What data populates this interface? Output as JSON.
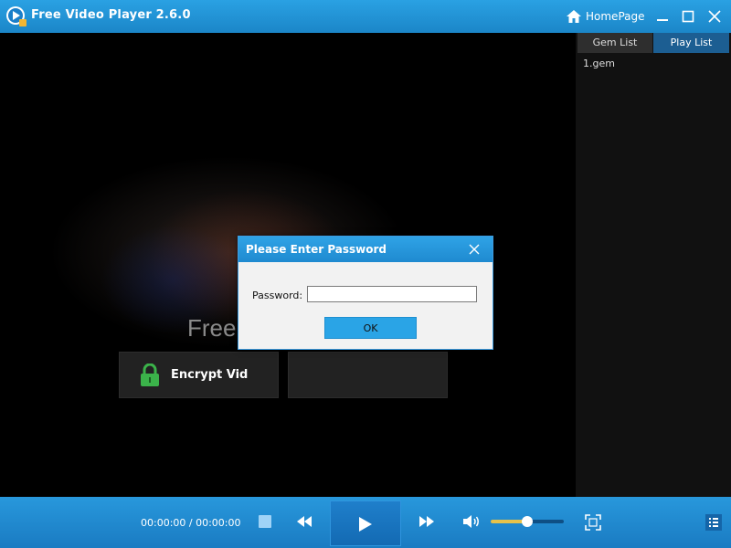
{
  "window": {
    "title": "Free Video Player 2.6.0",
    "homepage_label": "HomePage",
    "accent_color": "#1f8ad0"
  },
  "video": {
    "brand_text": "Free",
    "encrypt_label": "Encrypt Vid"
  },
  "playlist": {
    "tabs": [
      {
        "label": "Gem List",
        "active": false
      },
      {
        "label": "Play List",
        "active": true
      }
    ],
    "items": [
      {
        "name": "1.gem"
      }
    ]
  },
  "controls": {
    "time": "00:00:00 / 00:00:00",
    "volume_fraction": 0.5
  },
  "dialog": {
    "title": "Please Enter Password",
    "password_label": "Password:",
    "password_value": "",
    "ok_label": "OK"
  }
}
